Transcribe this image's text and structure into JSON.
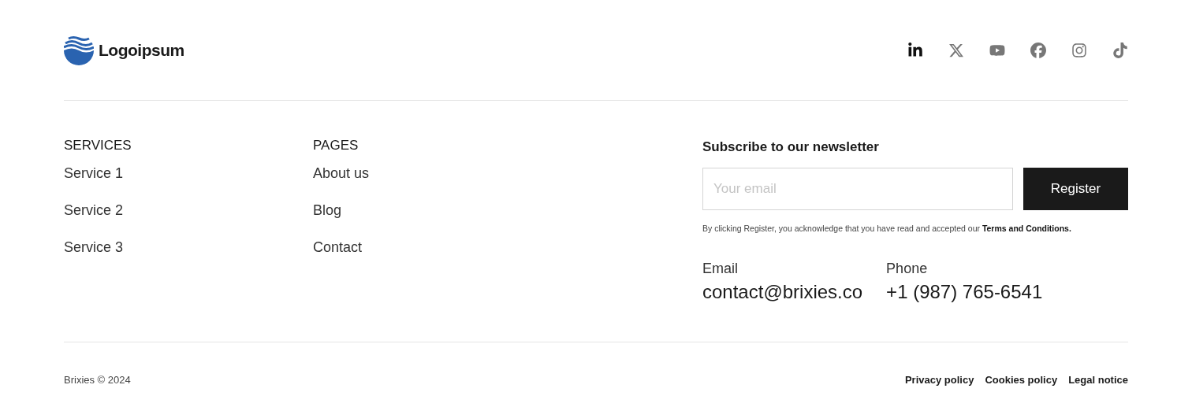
{
  "logo": {
    "text": "Logoipsum"
  },
  "social_links": [
    {
      "kind": "linkedin",
      "active": true
    },
    {
      "kind": "x",
      "active": false
    },
    {
      "kind": "youtube",
      "active": false
    },
    {
      "kind": "facebook",
      "active": false
    },
    {
      "kind": "instagram",
      "active": false
    },
    {
      "kind": "tiktok",
      "active": false
    }
  ],
  "columns": [
    {
      "heading": "SERVICES",
      "links": [
        "Service 1",
        "Service 2",
        "Service 3"
      ]
    },
    {
      "heading": "PAGES",
      "links": [
        "About us",
        "Blog",
        "Contact"
      ]
    }
  ],
  "newsletter": {
    "title": "Subscribe to our newsletter",
    "placeholder": "Your email",
    "button": "Register",
    "notice": "By clicking Register, you acknowledge that you have read and accepted our",
    "notice_link": "Terms and Conditions."
  },
  "contacts": [
    {
      "label": "Email",
      "value": "contact@brixies.co"
    },
    {
      "label": "Phone",
      "value": "+1 (987) 765-6541"
    }
  ],
  "copyright": "Brixies © 2024",
  "legal_links": [
    "Privacy policy",
    "Cookies policy",
    "Legal notice"
  ]
}
